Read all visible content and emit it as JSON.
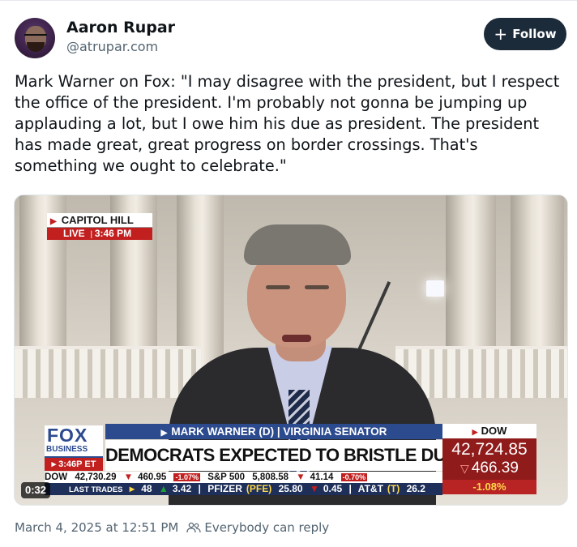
{
  "author": {
    "name": "Aaron Rupar",
    "handle": "@atrupar.com"
  },
  "follow_button": {
    "icon": "plus-icon",
    "label": "Follow"
  },
  "post": {
    "text": "Mark Warner on Fox: \"I may disagree with the president, but I respect the office of the president. I'm probably not gonna be jumping up applauding a lot, but I owe him his due as president. The president has made great, great progress on border crossings. That's something we ought to celebrate.\""
  },
  "video": {
    "duration": "0:32",
    "location_bug": {
      "place": "CAPITOL HILL",
      "live": "LIVE",
      "time": "3:46 PM"
    },
    "network": {
      "logo": "FOX",
      "sub": "BUSINESS",
      "time": "3:46P ET"
    },
    "lower_third": {
      "name": "MARK WARNER (D) | VIRGINIA SENATOR",
      "headline": "DEMOCRATS EXPECTED TO BRISTLE DURING TRUMP SPEECH"
    },
    "dow_box": {
      "label": "DOW",
      "value": "42,724.85",
      "change": "466.39",
      "percent": "-1.08%"
    },
    "ticker_top": {
      "dow_label": "DOW",
      "dow_value": "42,730.29",
      "dow_change": "460.95",
      "dow_pct": "-1.07%",
      "sp_label": "S&P 500",
      "sp_value": "5,808.58",
      "sp_change": "41.14",
      "sp_pct": "-0.70%"
    },
    "ticker_bottom": {
      "label": "LAST TRADES",
      "v1": "48",
      "v2": "3.42",
      "stock1": "PFIZER",
      "stock1_sym": "(PFE)",
      "stock1_price": "25.80",
      "stock1_change": "0.45",
      "stock2": "AT&T",
      "stock2_sym": "(T)",
      "stock2_price": "26.2"
    }
  },
  "meta": {
    "timestamp": "March 4, 2025 at 12:51 PM",
    "reply_setting": "Everybody can reply",
    "reply_icon": "people-icon"
  }
}
